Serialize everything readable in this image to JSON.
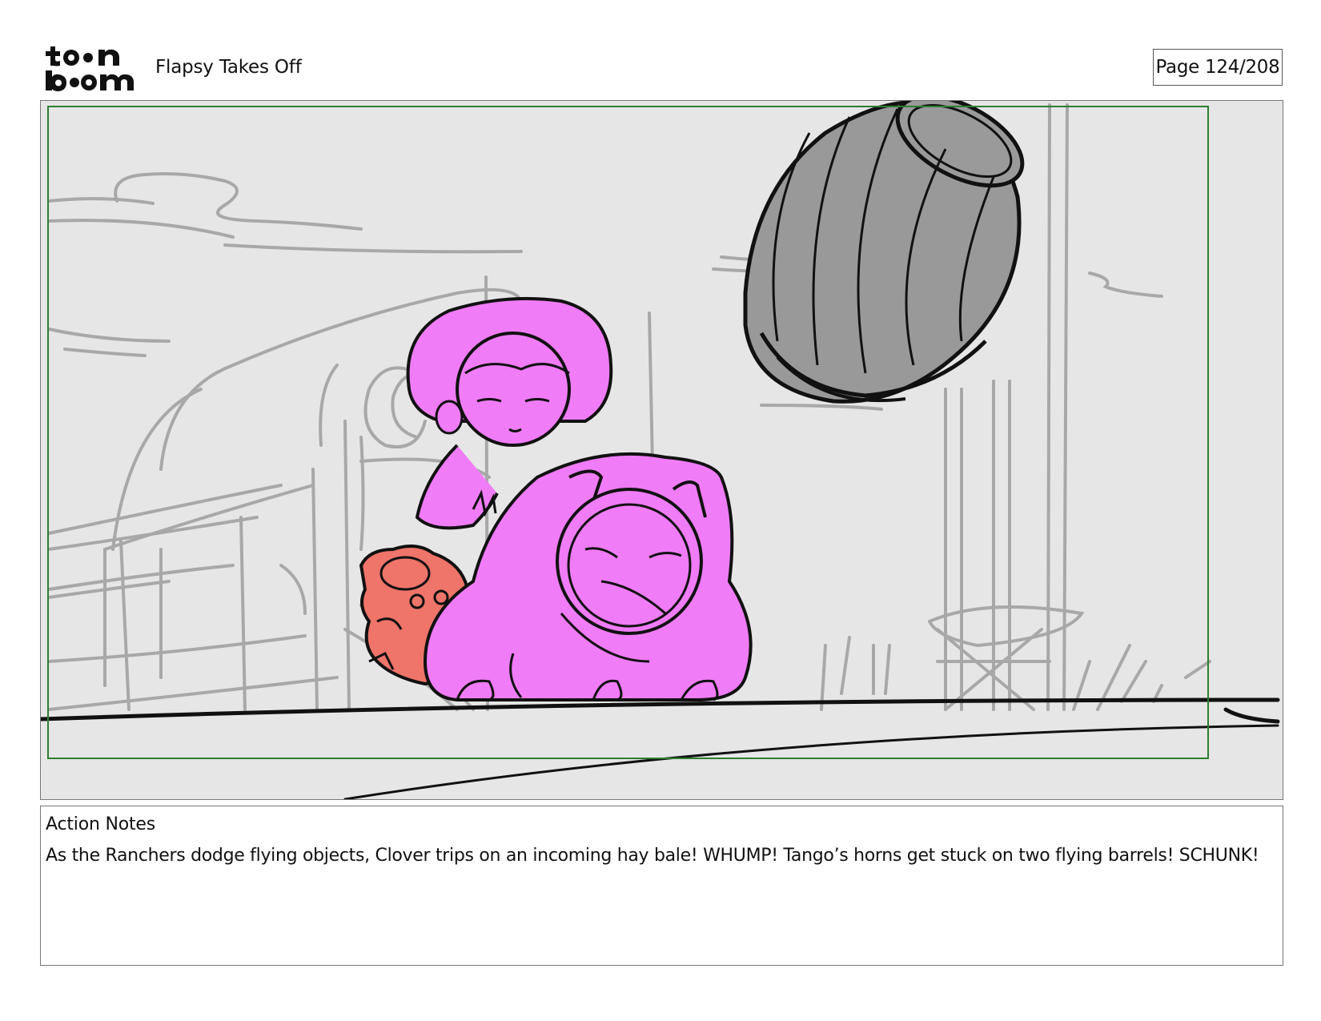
{
  "header": {
    "logo_text": "toon boom",
    "project_title": "Flapsy Takes Off",
    "page_label": "Page 124/208"
  },
  "panel": {
    "safe_area_color": "#2e7d32",
    "character_color": "#f07cf7",
    "small_character_color": "#ef7469",
    "barrel_color": "#999999",
    "background_sketch_color": "#a8a8a8"
  },
  "notes": {
    "header": "Action Notes",
    "body": "As the Ranchers dodge flying objects, Clover trips on an incoming hay bale! WHUMP! Tango’s horns get stuck on two flying barrels! SCHUNK!"
  }
}
